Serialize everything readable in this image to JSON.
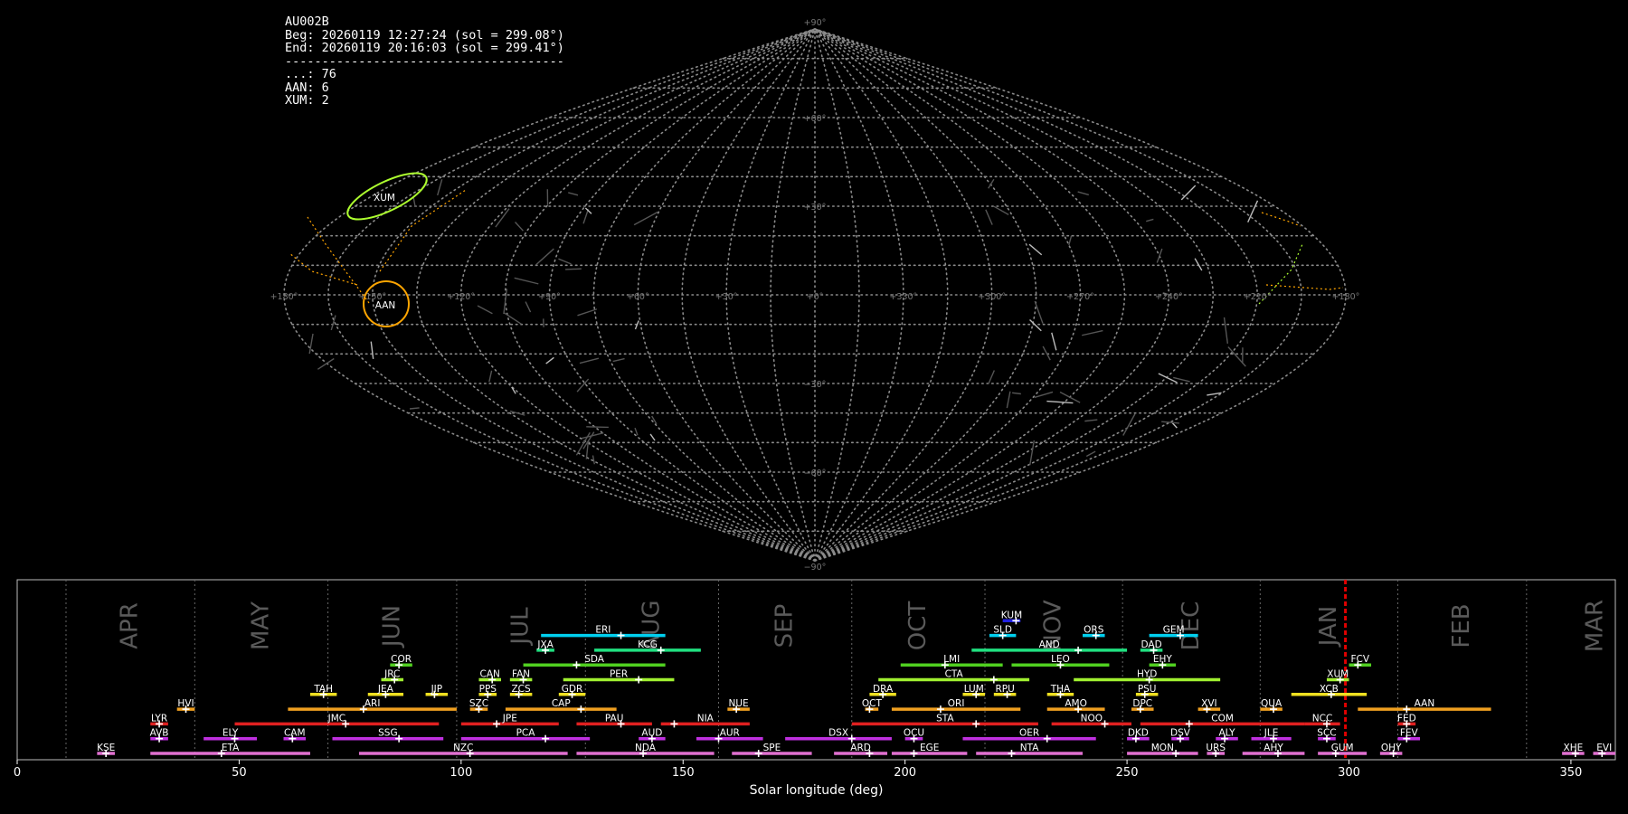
{
  "info": {
    "station": "AU002B",
    "begin": "Beg: 20260119 12:27:24 (sol = 299.08°)",
    "end": "End: 20260119 20:16:03 (sol = 299.41°)",
    "separator": "--------------------------------------",
    "counts": [
      {
        "label": "...",
        "count": 76
      },
      {
        "label": "AAN",
        "count": 6
      },
      {
        "label": "XUM",
        "count": 2
      }
    ],
    "count_lines": [
      "...: 76",
      "AAN: 6",
      "XUM: 2"
    ]
  },
  "sky_map": {
    "projection": "sinusoidal",
    "lat_labels": [
      "+90°",
      "+60°",
      "+30°",
      "−30°",
      "−60°",
      "−90°"
    ],
    "lon_labels": [
      "+180°",
      "+150°",
      "+120°",
      "+90°",
      "+60°",
      "+30°",
      "+0°",
      "+330°",
      "+300°",
      "+270°",
      "+240°",
      "+210°",
      "+180°"
    ],
    "radiants": [
      {
        "code": "XUM",
        "lon": 135,
        "lat": 32,
        "color": "#adff2f"
      },
      {
        "code": "AAN",
        "lon": 147,
        "lat": -3,
        "color": "#ffa500"
      }
    ]
  },
  "chart_data": {
    "type": "timeline",
    "xlabel": "Solar longitude (deg)",
    "xlim": [
      0,
      360
    ],
    "xticks": [
      0,
      50,
      100,
      150,
      200,
      250,
      300,
      350
    ],
    "current_sol": 299.2,
    "months": [
      {
        "name": "APR",
        "start": 11,
        "end": 40
      },
      {
        "name": "MAY",
        "start": 40,
        "end": 70
      },
      {
        "name": "JUN",
        "start": 70,
        "end": 99
      },
      {
        "name": "JUL",
        "start": 99,
        "end": 128
      },
      {
        "name": "AUG",
        "start": 128,
        "end": 158
      },
      {
        "name": "SEP",
        "start": 158,
        "end": 188
      },
      {
        "name": "OCT",
        "start": 188,
        "end": 218
      },
      {
        "name": "NOV",
        "start": 218,
        "end": 249
      },
      {
        "name": "DEC",
        "start": 249,
        "end": 280
      },
      {
        "name": "JAN",
        "start": 280,
        "end": 311
      },
      {
        "name": "FEB",
        "start": 311,
        "end": 340
      },
      {
        "name": "MAR",
        "start": 340,
        "end": 371
      }
    ],
    "showers": [
      {
        "code": "KUM",
        "start": 222,
        "end": 226,
        "peak": 225,
        "row": 9,
        "color": "#2020e0"
      },
      {
        "code": "ERI",
        "start": 118,
        "end": 146,
        "peak": 136,
        "row": 8,
        "color": "#00d0f0"
      },
      {
        "code": "SLD",
        "start": 219,
        "end": 225,
        "peak": 222,
        "row": 8,
        "color": "#00d0f0"
      },
      {
        "code": "ORS",
        "start": 240,
        "end": 245,
        "peak": 243,
        "row": 8,
        "color": "#00d0f0"
      },
      {
        "code": "GEM",
        "start": 255,
        "end": 266,
        "peak": 262,
        "row": 8,
        "color": "#00d0f0"
      },
      {
        "code": "JXA",
        "start": 117,
        "end": 121,
        "peak": 119,
        "row": 7,
        "color": "#20e080"
      },
      {
        "code": "KCG",
        "start": 130,
        "end": 154,
        "peak": 145,
        "row": 7,
        "color": "#20e080"
      },
      {
        "code": "AND",
        "start": 215,
        "end": 250,
        "peak": 239,
        "row": 7,
        "color": "#20e080"
      },
      {
        "code": "DAD",
        "start": 253,
        "end": 258,
        "peak": 256,
        "row": 7,
        "color": "#20e080"
      },
      {
        "code": "COR",
        "start": 84,
        "end": 89,
        "peak": 86,
        "row": 6,
        "color": "#50d020"
      },
      {
        "code": "SDA",
        "start": 114,
        "end": 146,
        "peak": 126,
        "row": 6,
        "color": "#50d020"
      },
      {
        "code": "LMI",
        "start": 199,
        "end": 222,
        "peak": 209,
        "row": 6,
        "color": "#50d020"
      },
      {
        "code": "LEO",
        "start": 224,
        "end": 246,
        "peak": 235,
        "row": 6,
        "color": "#50d020"
      },
      {
        "code": "EHY",
        "start": 255,
        "end": 261,
        "peak": 258,
        "row": 6,
        "color": "#50d020"
      },
      {
        "code": "FCV",
        "start": 300,
        "end": 305,
        "peak": 302,
        "row": 6,
        "color": "#50d020"
      },
      {
        "code": "JRC",
        "start": 82,
        "end": 87,
        "peak": 85,
        "row": 5,
        "color": "#a0f030"
      },
      {
        "code": "CAN",
        "start": 104,
        "end": 109,
        "peak": 107,
        "row": 5,
        "color": "#a0f030"
      },
      {
        "code": "FAN",
        "start": 111,
        "end": 116,
        "peak": 114,
        "row": 5,
        "color": "#a0f030"
      },
      {
        "code": "PER",
        "start": 123,
        "end": 148,
        "peak": 140,
        "row": 5,
        "color": "#a0f030"
      },
      {
        "code": "CTA",
        "start": 194,
        "end": 228,
        "peak": 220,
        "row": 5,
        "color": "#a0f030"
      },
      {
        "code": "HYD",
        "start": 238,
        "end": 271,
        "peak": 255,
        "row": 5,
        "color": "#a0f030"
      },
      {
        "code": "XUM",
        "start": 295,
        "end": 300,
        "peak": 298,
        "row": 5,
        "color": "#a0f030"
      },
      {
        "code": "TAH",
        "start": 66,
        "end": 72,
        "peak": 69,
        "row": 4,
        "color": "#f0e020"
      },
      {
        "code": "JEA",
        "start": 79,
        "end": 87,
        "peak": 83,
        "row": 4,
        "color": "#f0e020"
      },
      {
        "code": "JIP",
        "start": 92,
        "end": 97,
        "peak": 94,
        "row": 4,
        "color": "#f0e020"
      },
      {
        "code": "PPS",
        "start": 104,
        "end": 108,
        "peak": 106,
        "row": 4,
        "color": "#f0e020"
      },
      {
        "code": "ZCS",
        "start": 111,
        "end": 116,
        "peak": 113,
        "row": 4,
        "color": "#f0e020"
      },
      {
        "code": "GDR",
        "start": 122,
        "end": 128,
        "peak": 125,
        "row": 4,
        "color": "#f0e020"
      },
      {
        "code": "DRA",
        "start": 192,
        "end": 198,
        "peak": 195,
        "row": 4,
        "color": "#f0e020"
      },
      {
        "code": "LUM",
        "start": 213,
        "end": 218,
        "peak": 216,
        "row": 4,
        "color": "#f0e020"
      },
      {
        "code": "RPU",
        "start": 220,
        "end": 225,
        "peak": 223,
        "row": 4,
        "color": "#f0e020"
      },
      {
        "code": "THA",
        "start": 232,
        "end": 238,
        "peak": 235,
        "row": 4,
        "color": "#f0e020"
      },
      {
        "code": "PSU",
        "start": 252,
        "end": 257,
        "peak": 254,
        "row": 4,
        "color": "#f0e020"
      },
      {
        "code": "XCB",
        "start": 287,
        "end": 304,
        "peak": 296,
        "row": 4,
        "color": "#f0e020"
      },
      {
        "code": "HVI",
        "start": 36,
        "end": 40,
        "peak": 38,
        "row": 3,
        "color": "#f0a020"
      },
      {
        "code": "ARI",
        "start": 61,
        "end": 99,
        "peak": 78,
        "row": 3,
        "color": "#f0a020"
      },
      {
        "code": "SZC",
        "start": 102,
        "end": 106,
        "peak": 104,
        "row": 3,
        "color": "#f0a020"
      },
      {
        "code": "CAP",
        "start": 110,
        "end": 135,
        "peak": 127,
        "row": 3,
        "color": "#f0a020"
      },
      {
        "code": "NUE",
        "start": 160,
        "end": 165,
        "peak": 162,
        "row": 3,
        "color": "#f0a020"
      },
      {
        "code": "OCT",
        "start": 191,
        "end": 194,
        "peak": 192,
        "row": 3,
        "color": "#f0a020"
      },
      {
        "code": "ORI",
        "start": 197,
        "end": 226,
        "peak": 208,
        "row": 3,
        "color": "#f0a020"
      },
      {
        "code": "AMO",
        "start": 232,
        "end": 245,
        "peak": 239,
        "row": 3,
        "color": "#f0a020"
      },
      {
        "code": "DPC",
        "start": 251,
        "end": 256,
        "peak": 253,
        "row": 3,
        "color": "#f0a020"
      },
      {
        "code": "XVI",
        "start": 266,
        "end": 271,
        "peak": 268,
        "row": 3,
        "color": "#f0a020"
      },
      {
        "code": "QUA",
        "start": 280,
        "end": 285,
        "peak": 283,
        "row": 3,
        "color": "#f0a020"
      },
      {
        "code": "AAN",
        "start": 302,
        "end": 332,
        "peak": 313,
        "row": 3,
        "color": "#f0a020"
      },
      {
        "code": "LYR",
        "start": 30,
        "end": 34,
        "peak": 32,
        "row": 2,
        "color": "#e02020"
      },
      {
        "code": "JMC",
        "start": 49,
        "end": 95,
        "peak": 74,
        "row": 2,
        "color": "#e02020"
      },
      {
        "code": "JPE",
        "start": 100,
        "end": 122,
        "peak": 108,
        "row": 2,
        "color": "#e02020"
      },
      {
        "code": "PAU",
        "start": 126,
        "end": 143,
        "peak": 136,
        "row": 2,
        "color": "#e02020"
      },
      {
        "code": "NIA",
        "start": 145,
        "end": 165,
        "peak": 148,
        "row": 2,
        "color": "#e02020"
      },
      {
        "code": "STA",
        "start": 188,
        "end": 230,
        "peak": 216,
        "row": 2,
        "color": "#e02020"
      },
      {
        "code": "NOO",
        "start": 233,
        "end": 251,
        "peak": 245,
        "row": 2,
        "color": "#e02020"
      },
      {
        "code": "COM",
        "start": 253,
        "end": 290,
        "peak": 264,
        "row": 2,
        "color": "#e02020"
      },
      {
        "code": "NCC",
        "start": 290,
        "end": 298,
        "peak": 295,
        "row": 2,
        "color": "#e02020"
      },
      {
        "code": "FED",
        "start": 311,
        "end": 315,
        "peak": 313,
        "row": 2,
        "color": "#e02020"
      },
      {
        "code": "AVB",
        "start": 30,
        "end": 34,
        "peak": 32,
        "row": 1,
        "color": "#c030e0"
      },
      {
        "code": "ELY",
        "start": 42,
        "end": 54,
        "peak": 49,
        "row": 1,
        "color": "#c030e0"
      },
      {
        "code": "CAM",
        "start": 60,
        "end": 65,
        "peak": 62,
        "row": 1,
        "color": "#c030e0"
      },
      {
        "code": "SSG",
        "start": 71,
        "end": 96,
        "peak": 86,
        "row": 1,
        "color": "#c030e0"
      },
      {
        "code": "PCA",
        "start": 100,
        "end": 129,
        "peak": 119,
        "row": 1,
        "color": "#c030e0"
      },
      {
        "code": "AUD",
        "start": 140,
        "end": 146,
        "peak": 143,
        "row": 1,
        "color": "#c030e0"
      },
      {
        "code": "AUR",
        "start": 153,
        "end": 168,
        "peak": 158,
        "row": 1,
        "color": "#c030e0"
      },
      {
        "code": "DSX",
        "start": 173,
        "end": 197,
        "peak": 188,
        "row": 1,
        "color": "#c030e0"
      },
      {
        "code": "OCU",
        "start": 200,
        "end": 204,
        "peak": 202,
        "row": 1,
        "color": "#c030e0"
      },
      {
        "code": "OER",
        "start": 213,
        "end": 243,
        "peak": 232,
        "row": 1,
        "color": "#c030e0"
      },
      {
        "code": "DKD",
        "start": 250,
        "end": 255,
        "peak": 252,
        "row": 1,
        "color": "#c030e0"
      },
      {
        "code": "DSV",
        "start": 260,
        "end": 264,
        "peak": 262,
        "row": 1,
        "color": "#c030e0"
      },
      {
        "code": "ALY",
        "start": 270,
        "end": 275,
        "peak": 272,
        "row": 1,
        "color": "#c030e0"
      },
      {
        "code": "JLE",
        "start": 278,
        "end": 287,
        "peak": 283,
        "row": 1,
        "color": "#c030e0"
      },
      {
        "code": "SCC",
        "start": 293,
        "end": 297,
        "peak": 295,
        "row": 1,
        "color": "#c030e0"
      },
      {
        "code": "FEV",
        "start": 311,
        "end": 316,
        "peak": 313,
        "row": 1,
        "color": "#c030e0"
      },
      {
        "code": "KSE",
        "start": 18,
        "end": 22,
        "peak": 20,
        "row": 0,
        "color": "#e070d0"
      },
      {
        "code": "ETA",
        "start": 30,
        "end": 66,
        "peak": 46,
        "row": 0,
        "color": "#e070d0"
      },
      {
        "code": "NZC",
        "start": 77,
        "end": 124,
        "peak": 102,
        "row": 0,
        "color": "#e070d0"
      },
      {
        "code": "NDA",
        "start": 126,
        "end": 157,
        "peak": 141,
        "row": 0,
        "color": "#e070d0"
      },
      {
        "code": "SPE",
        "start": 161,
        "end": 179,
        "peak": 167,
        "row": 0,
        "color": "#e070d0"
      },
      {
        "code": "ARD",
        "start": 184,
        "end": 196,
        "peak": 192,
        "row": 0,
        "color": "#e070d0"
      },
      {
        "code": "EGE",
        "start": 197,
        "end": 214,
        "peak": 202,
        "row": 0,
        "color": "#e070d0"
      },
      {
        "code": "NTA",
        "start": 216,
        "end": 240,
        "peak": 224,
        "row": 0,
        "color": "#e070d0"
      },
      {
        "code": "MON",
        "start": 250,
        "end": 266,
        "peak": 261,
        "row": 0,
        "color": "#e070d0"
      },
      {
        "code": "URS",
        "start": 268,
        "end": 272,
        "peak": 270,
        "row": 0,
        "color": "#e070d0"
      },
      {
        "code": "AHY",
        "start": 276,
        "end": 290,
        "peak": 284,
        "row": 0,
        "color": "#e070d0"
      },
      {
        "code": "GUM",
        "start": 293,
        "end": 304,
        "peak": 297,
        "row": 0,
        "color": "#e070d0"
      },
      {
        "code": "OHY",
        "start": 307,
        "end": 312,
        "peak": 310,
        "row": 0,
        "color": "#e070d0"
      },
      {
        "code": "XHE",
        "start": 348,
        "end": 353,
        "peak": 351,
        "row": 0,
        "color": "#e070d0"
      },
      {
        "code": "EVI",
        "start": 355,
        "end": 360,
        "peak": 357,
        "row": 0,
        "color": "#e070d0"
      }
    ]
  }
}
